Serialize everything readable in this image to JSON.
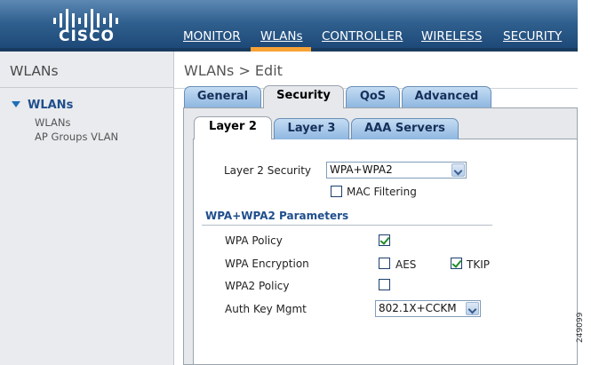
{
  "brand": {
    "name": "CISCO"
  },
  "nav": {
    "items": [
      {
        "label": "MONITOR"
      },
      {
        "label": "WLANs"
      },
      {
        "label": "CONTROLLER"
      },
      {
        "label": "WIRELESS"
      },
      {
        "label": "SECURITY"
      }
    ],
    "active": "WLANs"
  },
  "sidebar": {
    "title": "WLANs",
    "tree": {
      "head": "WLANs",
      "items": [
        {
          "label": "WLANs"
        },
        {
          "label": "AP Groups VLAN"
        }
      ]
    }
  },
  "main": {
    "title": "WLANs > Edit",
    "tabs": [
      {
        "label": "General"
      },
      {
        "label": "Security"
      },
      {
        "label": "QoS"
      },
      {
        "label": "Advanced"
      }
    ],
    "active_tab": "Security",
    "subtabs": [
      {
        "label": "Layer 2"
      },
      {
        "label": "Layer 3"
      },
      {
        "label": "AAA Servers"
      }
    ],
    "active_subtab": "Layer 2"
  },
  "form": {
    "layer2_security_label": "Layer 2 Security",
    "layer2_security_value": "WPA+WPA2",
    "mac_filtering_label": "MAC Filtering",
    "mac_filtering_checked": false,
    "section_title": "WPA+WPA2 Parameters",
    "wpa_policy_label": "WPA Policy",
    "wpa_policy_checked": true,
    "wpa_encryption_label": "WPA Encryption",
    "aes_label": "AES",
    "aes_checked": false,
    "tkip_label": "TKIP",
    "tkip_checked": true,
    "wpa2_policy_label": "WPA2 Policy",
    "wpa2_policy_checked": false,
    "auth_key_mgmt_label": "Auth Key Mgmt",
    "auth_key_mgmt_value": "802.1X+CCKM"
  },
  "figure_number": "249099",
  "colors": {
    "nav_bg": "#2f5f8e",
    "nav_active": "#f7a234",
    "tab_bg": "#a9c9ea",
    "section_head": "#1f4e8c",
    "check": "#1f8c2a"
  }
}
